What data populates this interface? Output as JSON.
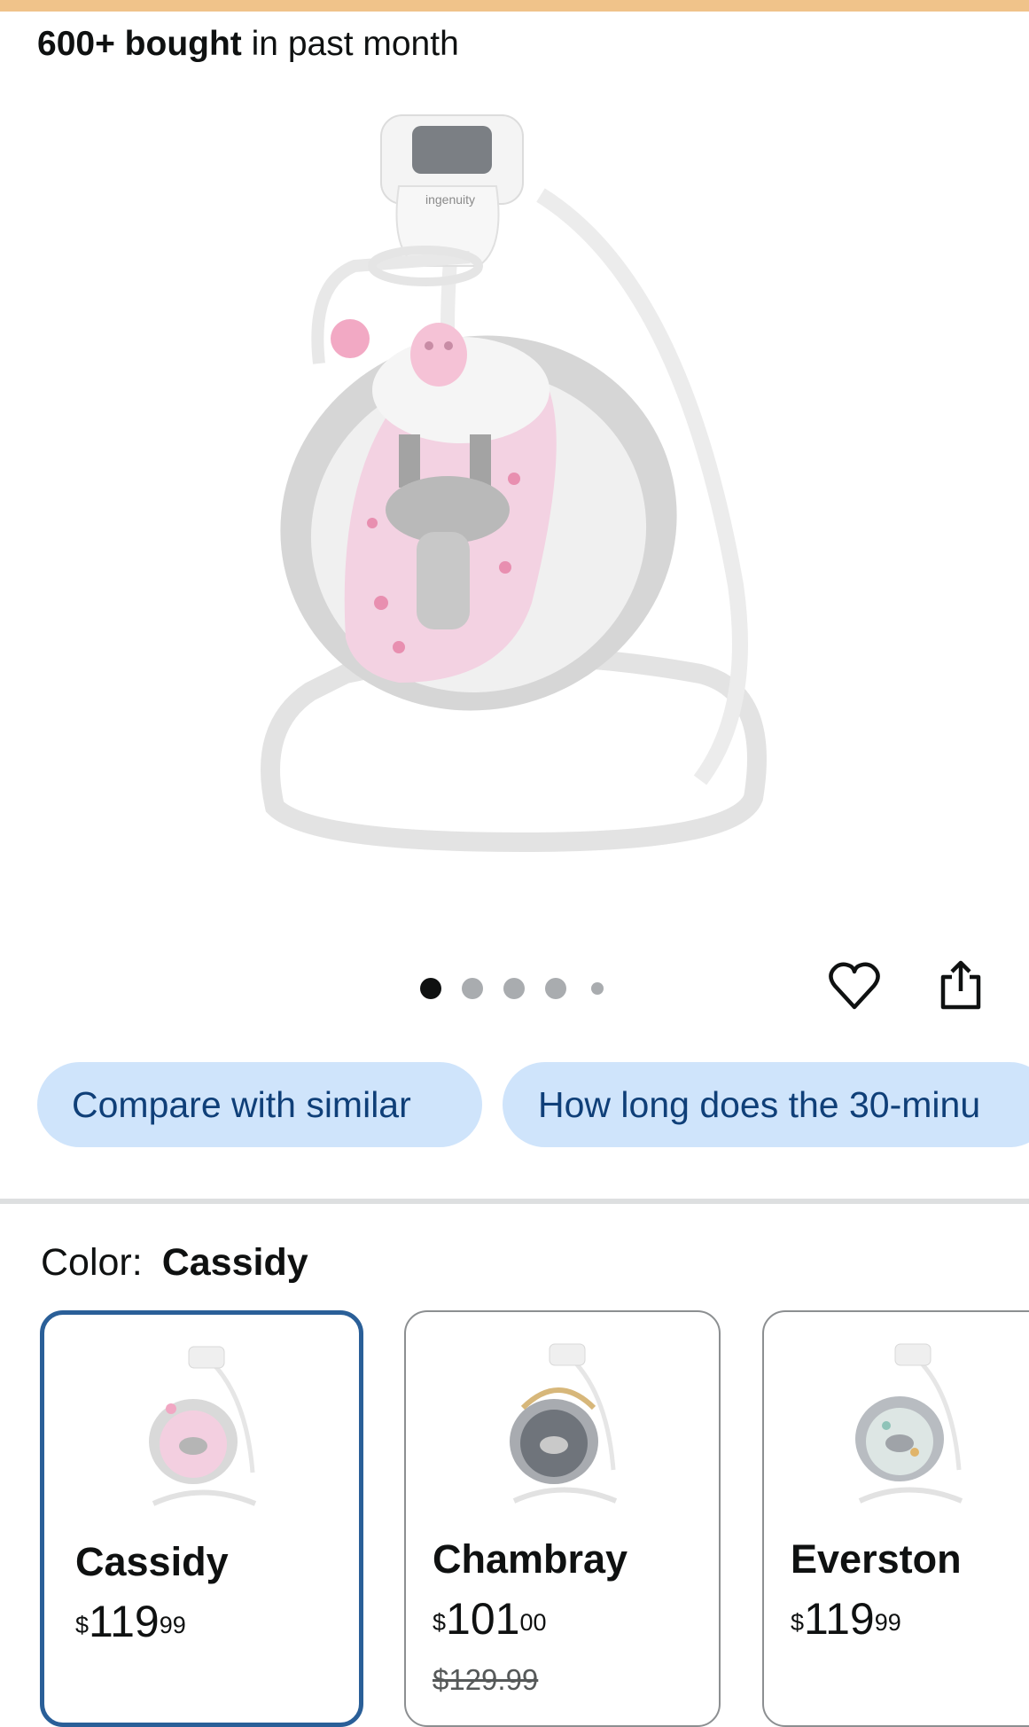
{
  "header": {
    "bought_strong": "600+ bought",
    "bought_rest": " in past month"
  },
  "gallery": {
    "image_count": 5,
    "active_index": 0,
    "brand_text": "ingenuity",
    "favorite_icon": "heart-icon",
    "share_icon": "share-icon"
  },
  "chips": [
    {
      "label": "Compare with similar"
    },
    {
      "label": "How long does the 30-minu"
    }
  ],
  "variation": {
    "label": "Color:",
    "selected_value": "Cassidy",
    "options": [
      {
        "name": "Cassidy",
        "currency": "$",
        "dollars": "119",
        "cents": "99",
        "selected": true
      },
      {
        "name": "Chambray",
        "currency": "$",
        "dollars": "101",
        "cents": "00",
        "was_price": "$129.99",
        "selected": false
      },
      {
        "name": "Everston",
        "currency": "$",
        "dollars": "119",
        "cents": "99",
        "selected": false
      }
    ]
  },
  "colors": {
    "top_bar": "#f0c38a",
    "chip_bg": "#cfe4fb",
    "chip_text": "#0f3f78",
    "selected_border": "#2a5f98",
    "text": "#0f1111"
  }
}
